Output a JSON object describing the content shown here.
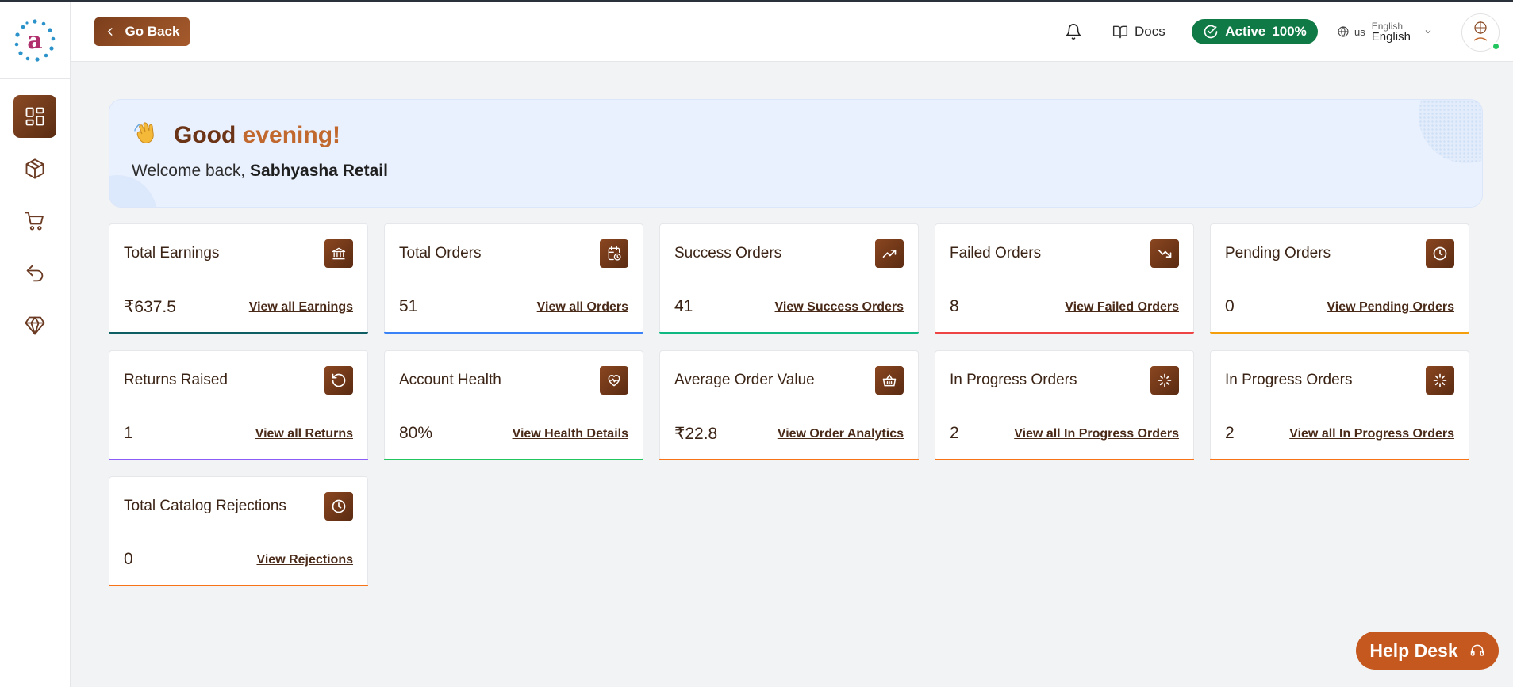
{
  "header": {
    "go_back_label": "Go Back",
    "docs_label": "Docs",
    "status_label": "Active",
    "status_percent": "100%",
    "lang_code": "us",
    "lang_small": "English",
    "lang_big": "English"
  },
  "greeting": {
    "title_part1": "Good",
    "title_part2": "evening!",
    "welcome_prefix": "Welcome back,",
    "user_name": "Sabhyasha Retail"
  },
  "sidebar": {
    "items": [
      {
        "name": "dashboard",
        "active": true
      },
      {
        "name": "products",
        "active": false
      },
      {
        "name": "orders",
        "active": false
      },
      {
        "name": "returns",
        "active": false
      },
      {
        "name": "premium",
        "active": false
      }
    ]
  },
  "cards": [
    {
      "title": "Total Earnings",
      "value": "₹637.5",
      "link": "View all Earnings",
      "icon": "bank-icon",
      "accent": "#0f5e63"
    },
    {
      "title": "Total Orders",
      "value": "51",
      "link": "View all Orders",
      "icon": "calendar-clock-icon",
      "accent": "#3b82f6"
    },
    {
      "title": "Success Orders",
      "value": "41",
      "link": "View Success Orders",
      "icon": "trend-up-icon",
      "accent": "#10b981"
    },
    {
      "title": "Failed Orders",
      "value": "8",
      "link": "View Failed Orders",
      "icon": "trend-down-icon",
      "accent": "#ef4444"
    },
    {
      "title": "Pending Orders",
      "value": "0",
      "link": "View Pending Orders",
      "icon": "clock-icon",
      "accent": "#f59e0b"
    },
    {
      "title": "Returns Raised",
      "value": "1",
      "link": "View all Returns",
      "icon": "rotate-icon",
      "accent": "#8b5cf6"
    },
    {
      "title": "Account Health",
      "value": "80%",
      "link": "View Health Details",
      "icon": "heart-pulse-icon",
      "accent": "#22c55e"
    },
    {
      "title": "Average Order Value",
      "value": "₹22.8",
      "link": "View Order Analytics",
      "icon": "basket-icon",
      "accent": "#f97316"
    },
    {
      "title": "In Progress Orders",
      "value": "2",
      "link": "View all In Progress Orders",
      "icon": "loader-icon",
      "accent": "#f97316"
    },
    {
      "title": "In Progress Orders",
      "value": "2",
      "link": "View all In Progress Orders",
      "icon": "loader-icon",
      "accent": "#f97316"
    },
    {
      "title": "Total Catalog Rejections",
      "value": "0",
      "link": "View Rejections",
      "icon": "clock-icon",
      "accent": "#f97316"
    }
  ],
  "helpdesk_label": "Help Desk",
  "colors": {
    "brand": "#7c3f1c",
    "active_green": "#0f7a45",
    "helpdesk": "#c4581e"
  }
}
